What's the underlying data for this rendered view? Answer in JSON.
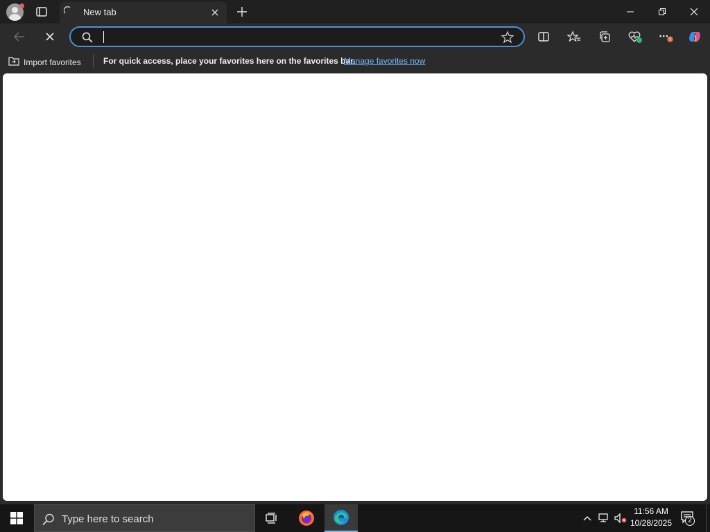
{
  "browser": {
    "tab": {
      "title": "New tab"
    },
    "addressbar": {
      "value": "",
      "placeholder": ""
    },
    "favorites_bar": {
      "import_label": "Import favorites",
      "message": "For quick access, place your favorites here on the favorites bar.",
      "manage_link": "Manage favorites now"
    },
    "colors": {
      "accent": "#4f8fd8",
      "link": "#6cb3f5",
      "chrome": "#2b2b2b",
      "tabstrip": "#202020"
    }
  },
  "taskbar": {
    "search_placeholder": "Type here to search",
    "clock": {
      "time": "11:56 AM",
      "date": "10/28/2025"
    },
    "notification_count": "2"
  }
}
